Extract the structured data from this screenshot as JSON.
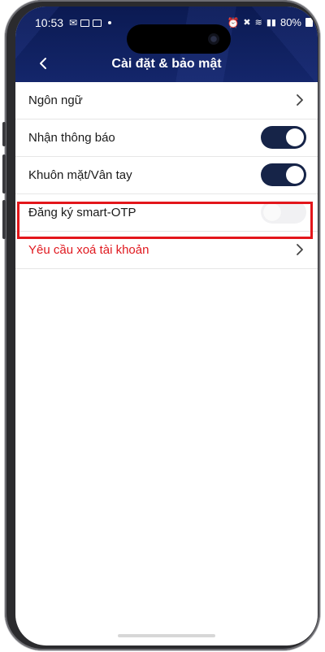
{
  "status_bar": {
    "time": "10:53",
    "signal_text": "80%"
  },
  "header": {
    "title": "Cài đặt & bảo mật"
  },
  "settings": [
    {
      "label": "Ngôn ngữ",
      "control": "chevron"
    },
    {
      "label": "Nhận thông báo",
      "control": "toggle",
      "state": "on"
    },
    {
      "label": "Khuôn mặt/Vân tay",
      "control": "toggle",
      "state": "on"
    },
    {
      "label": "Đăng ký smart-OTP",
      "control": "toggle",
      "state": "off",
      "highlighted": true
    },
    {
      "label": "Yêu cầu xoá tài khoản",
      "control": "chevron",
      "style": "danger"
    }
  ],
  "colors": {
    "header_bg": "#0b1a52",
    "toggle_on": "#162448",
    "danger_text": "#e0191f",
    "highlight_border": "#e3161b"
  }
}
